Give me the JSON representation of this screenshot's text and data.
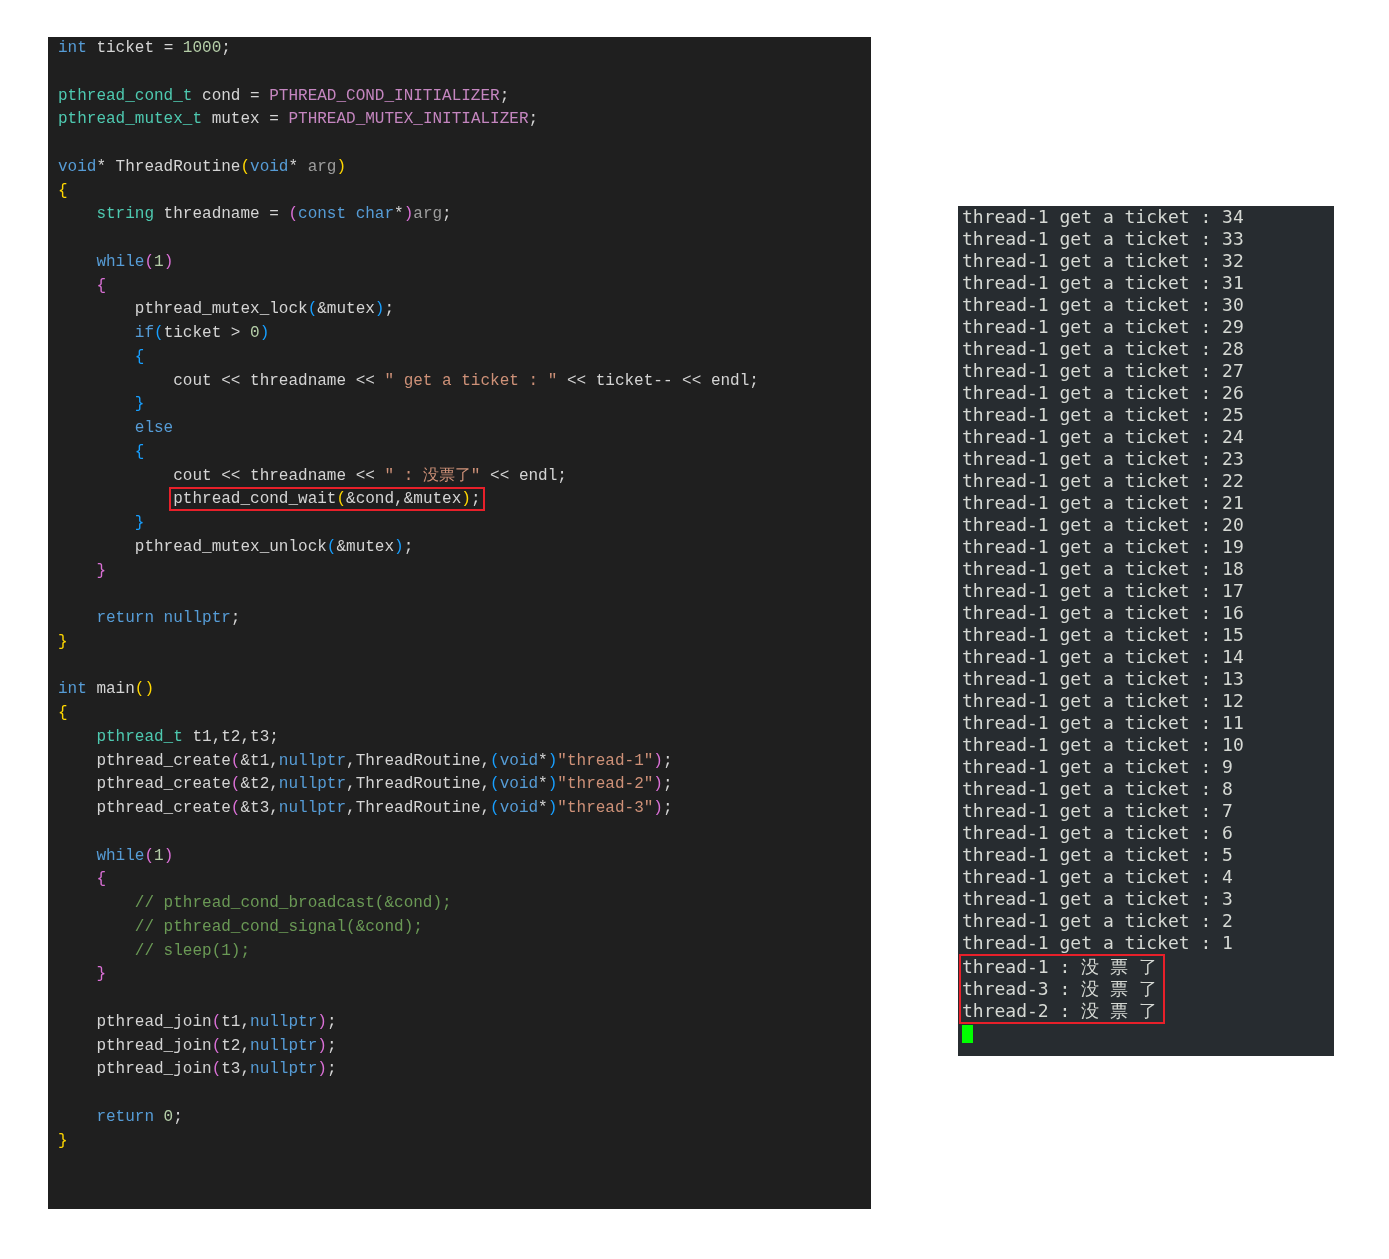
{
  "editor": {
    "blocks": [
      [
        [
          {
            "text": "int",
            "kind": "keyword"
          },
          {
            "text": " ticket = ",
            "kind": "plain"
          },
          {
            "text": "1000",
            "kind": "number"
          },
          {
            "text": ";",
            "kind": "plain"
          }
        ]
      ],
      [
        [
          {
            "text": "pthread_cond_t",
            "kind": "type"
          },
          {
            "text": " cond = ",
            "kind": "plain"
          },
          {
            "text": "PTHREAD_COND_INITIALIZER",
            "kind": "macro"
          },
          {
            "text": ";",
            "kind": "plain"
          }
        ],
        [
          {
            "text": "pthread_mutex_t",
            "kind": "type"
          },
          {
            "text": " mutex = ",
            "kind": "plain"
          },
          {
            "text": "PTHREAD_MUTEX_INITIALIZER",
            "kind": "macro"
          },
          {
            "text": ";",
            "kind": "plain"
          }
        ]
      ],
      [
        [
          {
            "text": "void",
            "kind": "keyword"
          },
          {
            "text": "* ThreadRoutine",
            "kind": "plain"
          },
          {
            "text": "(",
            "kind": "bracket1"
          },
          {
            "text": "void",
            "kind": "keyword"
          },
          {
            "text": "* ",
            "kind": "plain"
          },
          {
            "text": "arg",
            "kind": "unused"
          },
          {
            "text": ")",
            "kind": "bracket1"
          }
        ],
        [
          {
            "text": "{",
            "kind": "bracket1"
          }
        ],
        [
          {
            "text": "    string",
            "kind": "type"
          },
          {
            "text": " threadname = ",
            "kind": "plain"
          },
          {
            "text": "(",
            "kind": "bracket2"
          },
          {
            "text": "const char",
            "kind": "keyword"
          },
          {
            "text": "*",
            "kind": "plain"
          },
          {
            "text": ")",
            "kind": "bracket2"
          },
          {
            "text": "arg",
            "kind": "unused"
          },
          {
            "text": ";",
            "kind": "plain"
          }
        ]
      ],
      [
        [
          {
            "text": "    while",
            "kind": "keyword"
          },
          {
            "text": "(",
            "kind": "bracket2"
          },
          {
            "text": "1",
            "kind": "number"
          },
          {
            "text": ")",
            "kind": "bracket2"
          }
        ],
        [
          {
            "text": "    {",
            "kind": "bracket2"
          }
        ],
        [
          {
            "text": "        pthread_mutex_lock",
            "kind": "plain"
          },
          {
            "text": "(",
            "kind": "bracket3"
          },
          {
            "text": "&mutex",
            "kind": "plain"
          },
          {
            "text": ")",
            "kind": "bracket3"
          },
          {
            "text": ";",
            "kind": "plain"
          }
        ],
        [
          {
            "text": "        if",
            "kind": "keyword"
          },
          {
            "text": "(",
            "kind": "bracket3"
          },
          {
            "text": "ticket > ",
            "kind": "plain"
          },
          {
            "text": "0",
            "kind": "number"
          },
          {
            "text": ")",
            "kind": "bracket3"
          }
        ],
        [
          {
            "text": "        {",
            "kind": "bracket3"
          }
        ],
        [
          {
            "text": "            cout << threadname << ",
            "kind": "plain"
          },
          {
            "text": "\" get a ticket : \"",
            "kind": "string"
          },
          {
            "text": " << ticket-- << endl;",
            "kind": "plain"
          }
        ],
        [
          {
            "text": "        }",
            "kind": "bracket3"
          }
        ],
        [
          {
            "text": "        else",
            "kind": "keyword"
          }
        ],
        [
          {
            "text": "        {",
            "kind": "bracket3"
          }
        ],
        [
          {
            "text": "            cout << threadname << ",
            "kind": "plain"
          },
          {
            "text": "\" : 没票了\"",
            "kind": "string"
          },
          {
            "text": " << endl;",
            "kind": "plain"
          }
        ],
        [
          {
            "marked": [
              {
                "text": "            pthread_cond_wait",
                "kind": "plain"
              },
              {
                "text": "(",
                "kind": "bracket1"
              },
              {
                "text": "&cond,&mutex",
                "kind": "plain"
              },
              {
                "text": ")",
                "kind": "bracket1"
              },
              {
                "text": ";",
                "kind": "plain"
              }
            ]
          }
        ],
        [
          {
            "text": "        }",
            "kind": "bracket3"
          }
        ],
        [
          {
            "text": "        pthread_mutex_unlock",
            "kind": "plain"
          },
          {
            "text": "(",
            "kind": "bracket3"
          },
          {
            "text": "&mutex",
            "kind": "plain"
          },
          {
            "text": ")",
            "kind": "bracket3"
          },
          {
            "text": ";",
            "kind": "plain"
          }
        ],
        [
          {
            "text": "    }",
            "kind": "bracket2"
          }
        ]
      ],
      [
        [
          {
            "text": "    return nullptr",
            "kind": "keyword"
          },
          {
            "text": ";",
            "kind": "plain"
          }
        ],
        [
          {
            "text": "}",
            "kind": "bracket1"
          }
        ]
      ],
      [
        [
          {
            "text": "int",
            "kind": "keyword"
          },
          {
            "text": " main",
            "kind": "plain"
          },
          {
            "text": "()",
            "kind": "bracket1"
          }
        ],
        [
          {
            "text": "{",
            "kind": "bracket1"
          }
        ],
        [
          {
            "text": "    pthread_t",
            "kind": "type"
          },
          {
            "text": " t1,t2,t3;",
            "kind": "plain"
          }
        ],
        [
          {
            "text": "    pthread_create",
            "kind": "plain"
          },
          {
            "text": "(",
            "kind": "bracket2"
          },
          {
            "text": "&t1,",
            "kind": "plain"
          },
          {
            "text": "nullptr",
            "kind": "keyword"
          },
          {
            "text": ",ThreadRoutine,",
            "kind": "plain"
          },
          {
            "text": "(",
            "kind": "bracket3"
          },
          {
            "text": "void",
            "kind": "keyword"
          },
          {
            "text": "*",
            "kind": "plain"
          },
          {
            "text": ")",
            "kind": "bracket3"
          },
          {
            "text": "\"thread-1\"",
            "kind": "string"
          },
          {
            "text": ")",
            "kind": "bracket2"
          },
          {
            "text": ";",
            "kind": "plain"
          }
        ],
        [
          {
            "text": "    pthread_create",
            "kind": "plain"
          },
          {
            "text": "(",
            "kind": "bracket2"
          },
          {
            "text": "&t2,",
            "kind": "plain"
          },
          {
            "text": "nullptr",
            "kind": "keyword"
          },
          {
            "text": ",ThreadRoutine,",
            "kind": "plain"
          },
          {
            "text": "(",
            "kind": "bracket3"
          },
          {
            "text": "void",
            "kind": "keyword"
          },
          {
            "text": "*",
            "kind": "plain"
          },
          {
            "text": ")",
            "kind": "bracket3"
          },
          {
            "text": "\"thread-2\"",
            "kind": "string"
          },
          {
            "text": ")",
            "kind": "bracket2"
          },
          {
            "text": ";",
            "kind": "plain"
          }
        ],
        [
          {
            "text": "    pthread_create",
            "kind": "plain"
          },
          {
            "text": "(",
            "kind": "bracket2"
          },
          {
            "text": "&t3,",
            "kind": "plain"
          },
          {
            "text": "nullptr",
            "kind": "keyword"
          },
          {
            "text": ",ThreadRoutine,",
            "kind": "plain"
          },
          {
            "text": "(",
            "kind": "bracket3"
          },
          {
            "text": "void",
            "kind": "keyword"
          },
          {
            "text": "*",
            "kind": "plain"
          },
          {
            "text": ")",
            "kind": "bracket3"
          },
          {
            "text": "\"thread-3\"",
            "kind": "string"
          },
          {
            "text": ")",
            "kind": "bracket2"
          },
          {
            "text": ";",
            "kind": "plain"
          }
        ]
      ],
      [
        [
          {
            "text": "    while",
            "kind": "keyword"
          },
          {
            "text": "(",
            "kind": "bracket2"
          },
          {
            "text": "1",
            "kind": "number"
          },
          {
            "text": ")",
            "kind": "bracket2"
          }
        ],
        [
          {
            "text": "    {",
            "kind": "bracket2"
          }
        ],
        [
          {
            "text": "        // pthread_cond_broadcast(&cond);",
            "kind": "comment"
          }
        ],
        [
          {
            "text": "        // pthread_cond_signal(&cond);",
            "kind": "comment"
          }
        ],
        [
          {
            "text": "        // sleep(1);",
            "kind": "comment"
          }
        ],
        [
          {
            "text": "    }",
            "kind": "bracket2"
          }
        ]
      ],
      [
        [
          {
            "text": "    pthread_join",
            "kind": "plain"
          },
          {
            "text": "(",
            "kind": "bracket2"
          },
          {
            "text": "t1,",
            "kind": "plain"
          },
          {
            "text": "nullptr",
            "kind": "keyword"
          },
          {
            "text": ")",
            "kind": "bracket2"
          },
          {
            "text": ";",
            "kind": "plain"
          }
        ],
        [
          {
            "text": "    pthread_join",
            "kind": "plain"
          },
          {
            "text": "(",
            "kind": "bracket2"
          },
          {
            "text": "t2,",
            "kind": "plain"
          },
          {
            "text": "nullptr",
            "kind": "keyword"
          },
          {
            "text": ")",
            "kind": "bracket2"
          },
          {
            "text": ";",
            "kind": "plain"
          }
        ],
        [
          {
            "text": "    pthread_join",
            "kind": "plain"
          },
          {
            "text": "(",
            "kind": "bracket2"
          },
          {
            "text": "t3,",
            "kind": "plain"
          },
          {
            "text": "nullptr",
            "kind": "keyword"
          },
          {
            "text": ")",
            "kind": "bracket2"
          },
          {
            "text": ";",
            "kind": "plain"
          }
        ]
      ],
      [
        [
          {
            "text": "    return",
            "kind": "keyword"
          },
          {
            "text": " 0",
            "kind": "number"
          },
          {
            "text": ";",
            "kind": "plain"
          }
        ],
        [
          {
            "text": "}",
            "kind": "bracket1"
          }
        ]
      ]
    ]
  },
  "terminal": {
    "lines": [
      "thread-1 get a ticket : 34",
      "thread-1 get a ticket : 33",
      "thread-1 get a ticket : 32",
      "thread-1 get a ticket : 31",
      "thread-1 get a ticket : 30",
      "thread-1 get a ticket : 29",
      "thread-1 get a ticket : 28",
      "thread-1 get a ticket : 27",
      "thread-1 get a ticket : 26",
      "thread-1 get a ticket : 25",
      "thread-1 get a ticket : 24",
      "thread-1 get a ticket : 23",
      "thread-1 get a ticket : 22",
      "thread-1 get a ticket : 21",
      "thread-1 get a ticket : 20",
      "thread-1 get a ticket : 19",
      "thread-1 get a ticket : 18",
      "thread-1 get a ticket : 17",
      "thread-1 get a ticket : 16",
      "thread-1 get a ticket : 15",
      "thread-1 get a ticket : 14",
      "thread-1 get a ticket : 13",
      "thread-1 get a ticket : 12",
      "thread-1 get a ticket : 11",
      "thread-1 get a ticket : 10",
      "thread-1 get a ticket : 9",
      "thread-1 get a ticket : 8",
      "thread-1 get a ticket : 7",
      "thread-1 get a ticket : 6",
      "thread-1 get a ticket : 5",
      "thread-1 get a ticket : 4",
      "thread-1 get a ticket : 3",
      "thread-1 get a ticket : 2",
      "thread-1 get a ticket : 1"
    ],
    "marked_lines": [
      "thread-1 : 没 票 了",
      "thread-3 : 没 票 了",
      "thread-2 : 没 票 了"
    ]
  }
}
